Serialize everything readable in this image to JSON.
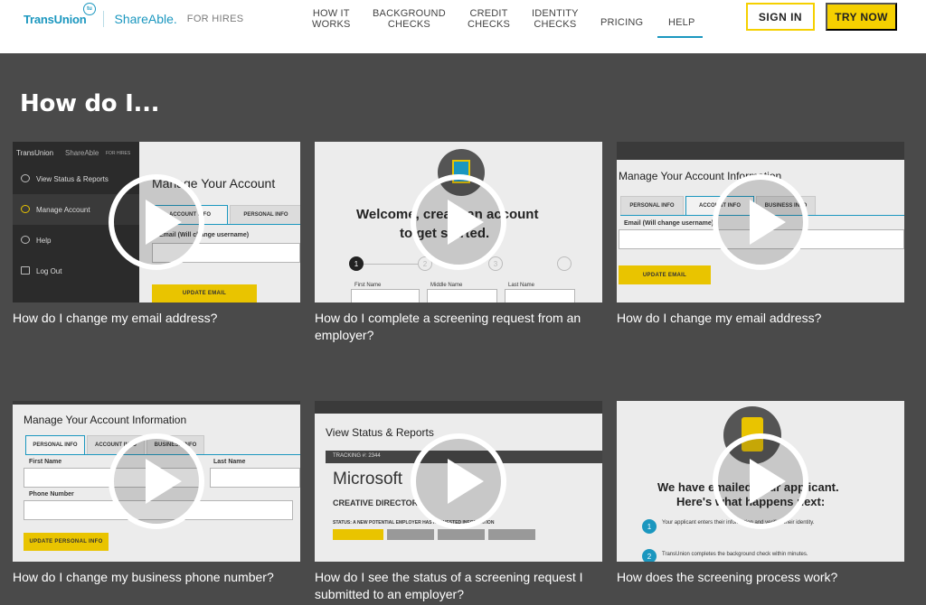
{
  "brand": {
    "transunion": "TransUnion",
    "badge": "tu",
    "shareable": "ShareAble.",
    "for_hires": "FOR HIRES"
  },
  "nav": {
    "how_it_works": [
      "HOW IT",
      "WORKS"
    ],
    "background_checks": [
      "BACKGROUND",
      "CHECKS"
    ],
    "credit_checks": [
      "CREDIT",
      "CHECKS"
    ],
    "identity_checks": [
      "IDENTITY",
      "CHECKS"
    ],
    "pricing": "PRICING",
    "help": "HELP",
    "active": "HELP"
  },
  "buttons": {
    "sign_in": "SIGN IN",
    "try_now": "TRY NOW"
  },
  "page_title": "How do I...",
  "videos": [
    {
      "caption": "How do I change my email address?",
      "thumb": {
        "brand": "TransUnion",
        "brand2": "ShareAble",
        "brand3": "FOR HIRES",
        "menu": [
          "View Status & Reports",
          "Manage Account",
          "Help",
          "Log Out"
        ],
        "heading": "Manage Your Account",
        "tab1": "ACCOUNT INFO",
        "tab2": "PERSONAL INFO",
        "label": "Email (Will change username)",
        "button": "UPDATE EMAIL"
      }
    },
    {
      "caption": "How do I complete a screening request from an employer?",
      "thumb": {
        "heading1": "Welcome, create an account",
        "heading2": "to get started.",
        "steps": [
          "1",
          "2",
          "3"
        ],
        "fields": [
          "First Name",
          "Middle Name",
          "Last Name"
        ]
      }
    },
    {
      "caption": "How do I change my email address?",
      "thumb": {
        "heading": "Manage Your Account Information",
        "tab1": "PERSONAL INFO",
        "tab2": "ACCOUNT INFO",
        "tab3": "BUSINESS INFO",
        "label": "Email (Will change username)",
        "button": "UPDATE EMAIL"
      }
    },
    {
      "caption": "How do I change my business phone number?",
      "thumb": {
        "heading": "Manage Your Account Information",
        "tab1": "PERSONAL INFO",
        "tab2": "ACCOUNT INFO",
        "tab3": "BUSINESS INFO",
        "first": "First Name",
        "last": "Last Name",
        "phone": "Phone Number",
        "button": "UPDATE PERSONAL INFO"
      }
    },
    {
      "caption": "How do I see the status of a screening request I submitted to an employer?",
      "thumb": {
        "heading": "View Status & Reports",
        "tracking": "TRACKING #: 2344",
        "company": "Microsoft",
        "role": "CREATIVE DIRECTOR",
        "status": "STATUS: A NEW POTENTIAL EMPLOYER HAS REQUESTED INFORMATION"
      }
    },
    {
      "caption": "How does the screening process work?",
      "thumb": {
        "heading1": "We have emailed your applicant.",
        "heading2": "Here's what happens next:",
        "step1": "Your applicant enters their information and verifies their identity.",
        "step2": "TransUnion completes the background check within minutes.",
        "n1": "1",
        "n2": "2"
      }
    }
  ],
  "colors": {
    "brand_blue": "#1b97bf",
    "accent_yellow": "#f5d000",
    "background": "#4a4a4a"
  }
}
